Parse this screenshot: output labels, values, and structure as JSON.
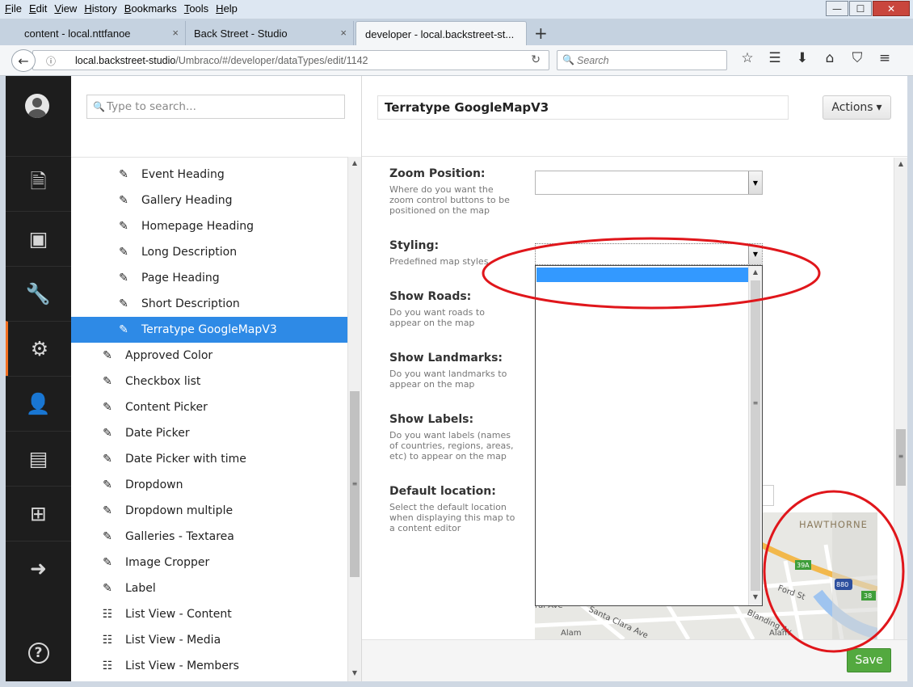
{
  "browser": {
    "menu": [
      "File",
      "Edit",
      "View",
      "History",
      "Bookmarks",
      "Tools",
      "Help"
    ],
    "window_buttons": {
      "minimize": "—",
      "maximize": "☐",
      "close": "✕"
    },
    "tabs": [
      {
        "title": "content - local.nttfanoe"
      },
      {
        "title": "Back Street - Studio"
      },
      {
        "title": "developer - local.backstreet-st..."
      }
    ],
    "tab_close": "×",
    "new_tab": "+",
    "url": {
      "host": "local.backstreet-studio",
      "path": "/Umbraco/#/developer/dataTypes/edit/1142"
    },
    "search_placeholder": "Search",
    "icons": {
      "back": "←",
      "info": "ⓘ",
      "reload": "↻",
      "search": "🔍",
      "bookmark": "☆",
      "reading": "☰",
      "download": "⬇",
      "home": "⌂",
      "pocket": "⛉",
      "menu": "≡"
    }
  },
  "umbraco": {
    "sections": [
      {
        "icon": "🗎",
        "name": "content"
      },
      {
        "icon": "▣",
        "name": "media"
      },
      {
        "icon": "🔧",
        "name": "settings"
      },
      {
        "icon": "⚙",
        "name": "developer"
      },
      {
        "icon": "👤",
        "name": "users"
      },
      {
        "icon": "▤",
        "name": "members"
      },
      {
        "icon": "⊞",
        "name": "forms"
      },
      {
        "icon": "➜",
        "name": "translation"
      }
    ],
    "help_icon": "?",
    "tree": {
      "search_placeholder": "Type to search...",
      "items": [
        {
          "label": "Event Heading",
          "icon": "✎",
          "indent": 2
        },
        {
          "label": "Gallery Heading",
          "icon": "✎",
          "indent": 2
        },
        {
          "label": "Homepage Heading",
          "icon": "✎",
          "indent": 2
        },
        {
          "label": "Long Description",
          "icon": "✎",
          "indent": 2
        },
        {
          "label": "Page Heading",
          "icon": "✎",
          "indent": 2
        },
        {
          "label": "Short Description",
          "icon": "✎",
          "indent": 2
        },
        {
          "label": "Terratype GoogleMapV3",
          "icon": "✎",
          "indent": 2,
          "selected": true
        },
        {
          "label": "Approved Color",
          "icon": "✎",
          "indent": 1
        },
        {
          "label": "Checkbox list",
          "icon": "✎",
          "indent": 1
        },
        {
          "label": "Content Picker",
          "icon": "✎",
          "indent": 1
        },
        {
          "label": "Date Picker",
          "icon": "✎",
          "indent": 1
        },
        {
          "label": "Date Picker with time",
          "icon": "✎",
          "indent": 1
        },
        {
          "label": "Dropdown",
          "icon": "✎",
          "indent": 1
        },
        {
          "label": "Dropdown multiple",
          "icon": "✎",
          "indent": 1
        },
        {
          "label": "Galleries - Textarea",
          "icon": "✎",
          "indent": 1
        },
        {
          "label": "Image Cropper",
          "icon": "✎",
          "indent": 1
        },
        {
          "label": "Label",
          "icon": "✎",
          "indent": 1
        },
        {
          "label": "List View - Content",
          "icon": "☷",
          "indent": 1
        },
        {
          "label": "List View - Media",
          "icon": "☷",
          "indent": 1
        },
        {
          "label": "List View - Members",
          "icon": "☷",
          "indent": 1
        }
      ]
    },
    "editor": {
      "name": "Terratype GoogleMapV3",
      "actions_label": "Actions",
      "actions_caret": "▾",
      "properties": [
        {
          "label": "Zoom Position:",
          "description": "Where do you want the zoom control buttons to be positioned on the map"
        },
        {
          "label": "Styling:",
          "description": "Predefined map styles"
        },
        {
          "label": "Show Roads:",
          "description": "Do you want roads to appear on the map"
        },
        {
          "label": "Show Landmarks:",
          "description": "Do you want landmarks to appear on the map"
        },
        {
          "label": "Show Labels:",
          "description": "Do you want labels (names of countries, regions, areas, etc) to appear on the map"
        },
        {
          "label": "Default location:",
          "description": "Select the default location when displaying this map to a content editor"
        }
      ],
      "select_arrow": "▼",
      "scroll_up": "▲",
      "scroll_down": "▼",
      "grip": "≡",
      "map_labels": {
        "hawthorne": "HAWTHORNE",
        "ford": "Ford St",
        "santa_clara": "Santa Clara Ave",
        "blanding": "Blanding Av",
        "ral": "ral Ave",
        "alam1": "Alam",
        "alam2": "Alam",
        "shield_39a": "39A",
        "shield_38": "38",
        "shield_880": "880"
      },
      "save_label": "Save"
    }
  },
  "colors": {
    "accent": "#2e8ae6",
    "save": "#53a93f",
    "nav_active": "#f36f21",
    "annotation": "#e0161b"
  }
}
